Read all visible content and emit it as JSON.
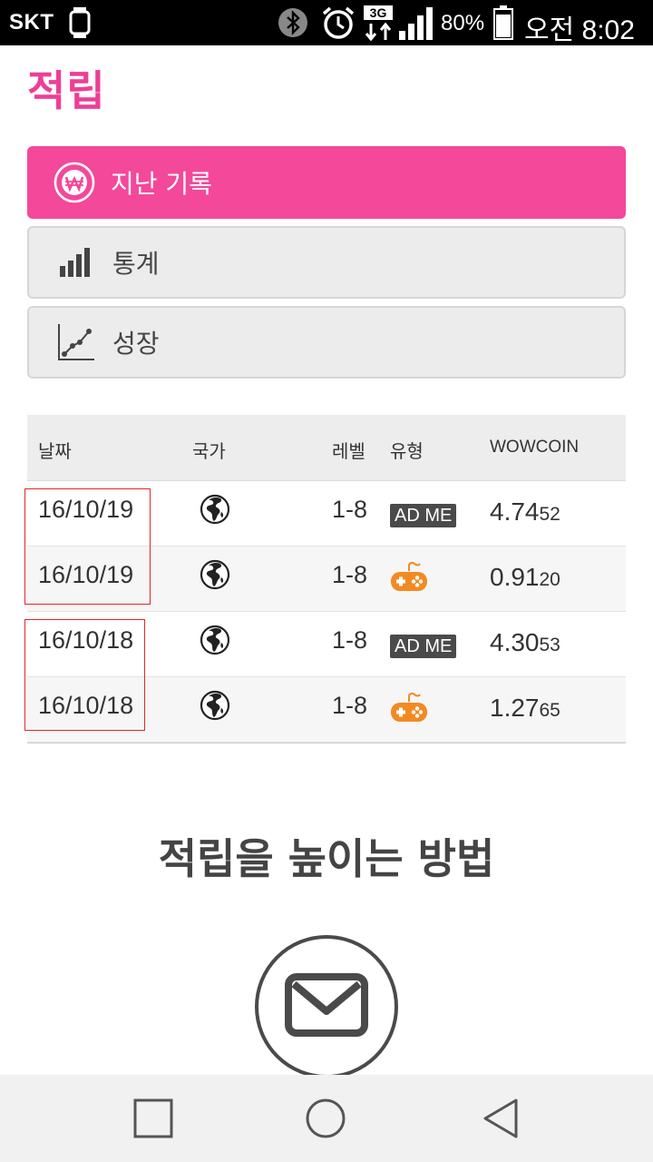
{
  "status_bar": {
    "carrier": "SKT",
    "network": "3G",
    "battery_percent": "80%",
    "time": "오전 8:02",
    "icons": [
      "watch-icon",
      "bluetooth-icon",
      "alarm-icon",
      "network-3g-icon",
      "signal-icon",
      "battery-icon"
    ]
  },
  "page": {
    "title": "적립"
  },
  "menu": {
    "items": [
      {
        "label": "지난 기록",
        "icon": "won-coin-icon",
        "active": true
      },
      {
        "label": "통계",
        "icon": "bar-chart-icon",
        "active": false
      },
      {
        "label": "성장",
        "icon": "line-chart-icon",
        "active": false
      }
    ]
  },
  "table": {
    "headers": {
      "date": "날짜",
      "country": "국가",
      "level": "레벨",
      "type": "유형",
      "coin": "WOWCOIN"
    },
    "rows": [
      {
        "date": "16/10/19",
        "country": "globe-icon",
        "level": "1-8",
        "type": "AD ME",
        "coin_main": "4.74",
        "coin_small": "52"
      },
      {
        "date": "16/10/19",
        "country": "globe-icon",
        "level": "1-8",
        "type": "gamepad-icon",
        "coin_main": "0.91",
        "coin_small": "20"
      },
      {
        "date": "16/10/18",
        "country": "globe-icon",
        "level": "1-8",
        "type": "AD ME",
        "coin_main": "4.30",
        "coin_small": "53"
      },
      {
        "date": "16/10/18",
        "country": "globe-icon",
        "level": "1-8",
        "type": "gamepad-icon",
        "coin_main": "1.27",
        "coin_small": "65"
      }
    ]
  },
  "howto": {
    "title": "적립을 높이는 방법",
    "icon": "mail-icon"
  },
  "navbar": {
    "icons": [
      "recent-apps-icon",
      "home-icon",
      "back-icon"
    ]
  },
  "colors": {
    "accent": "#f4489a",
    "title_pink": "#ee3e96",
    "gamepad_orange": "#f28a24",
    "highlight_red": "#e1262b"
  }
}
